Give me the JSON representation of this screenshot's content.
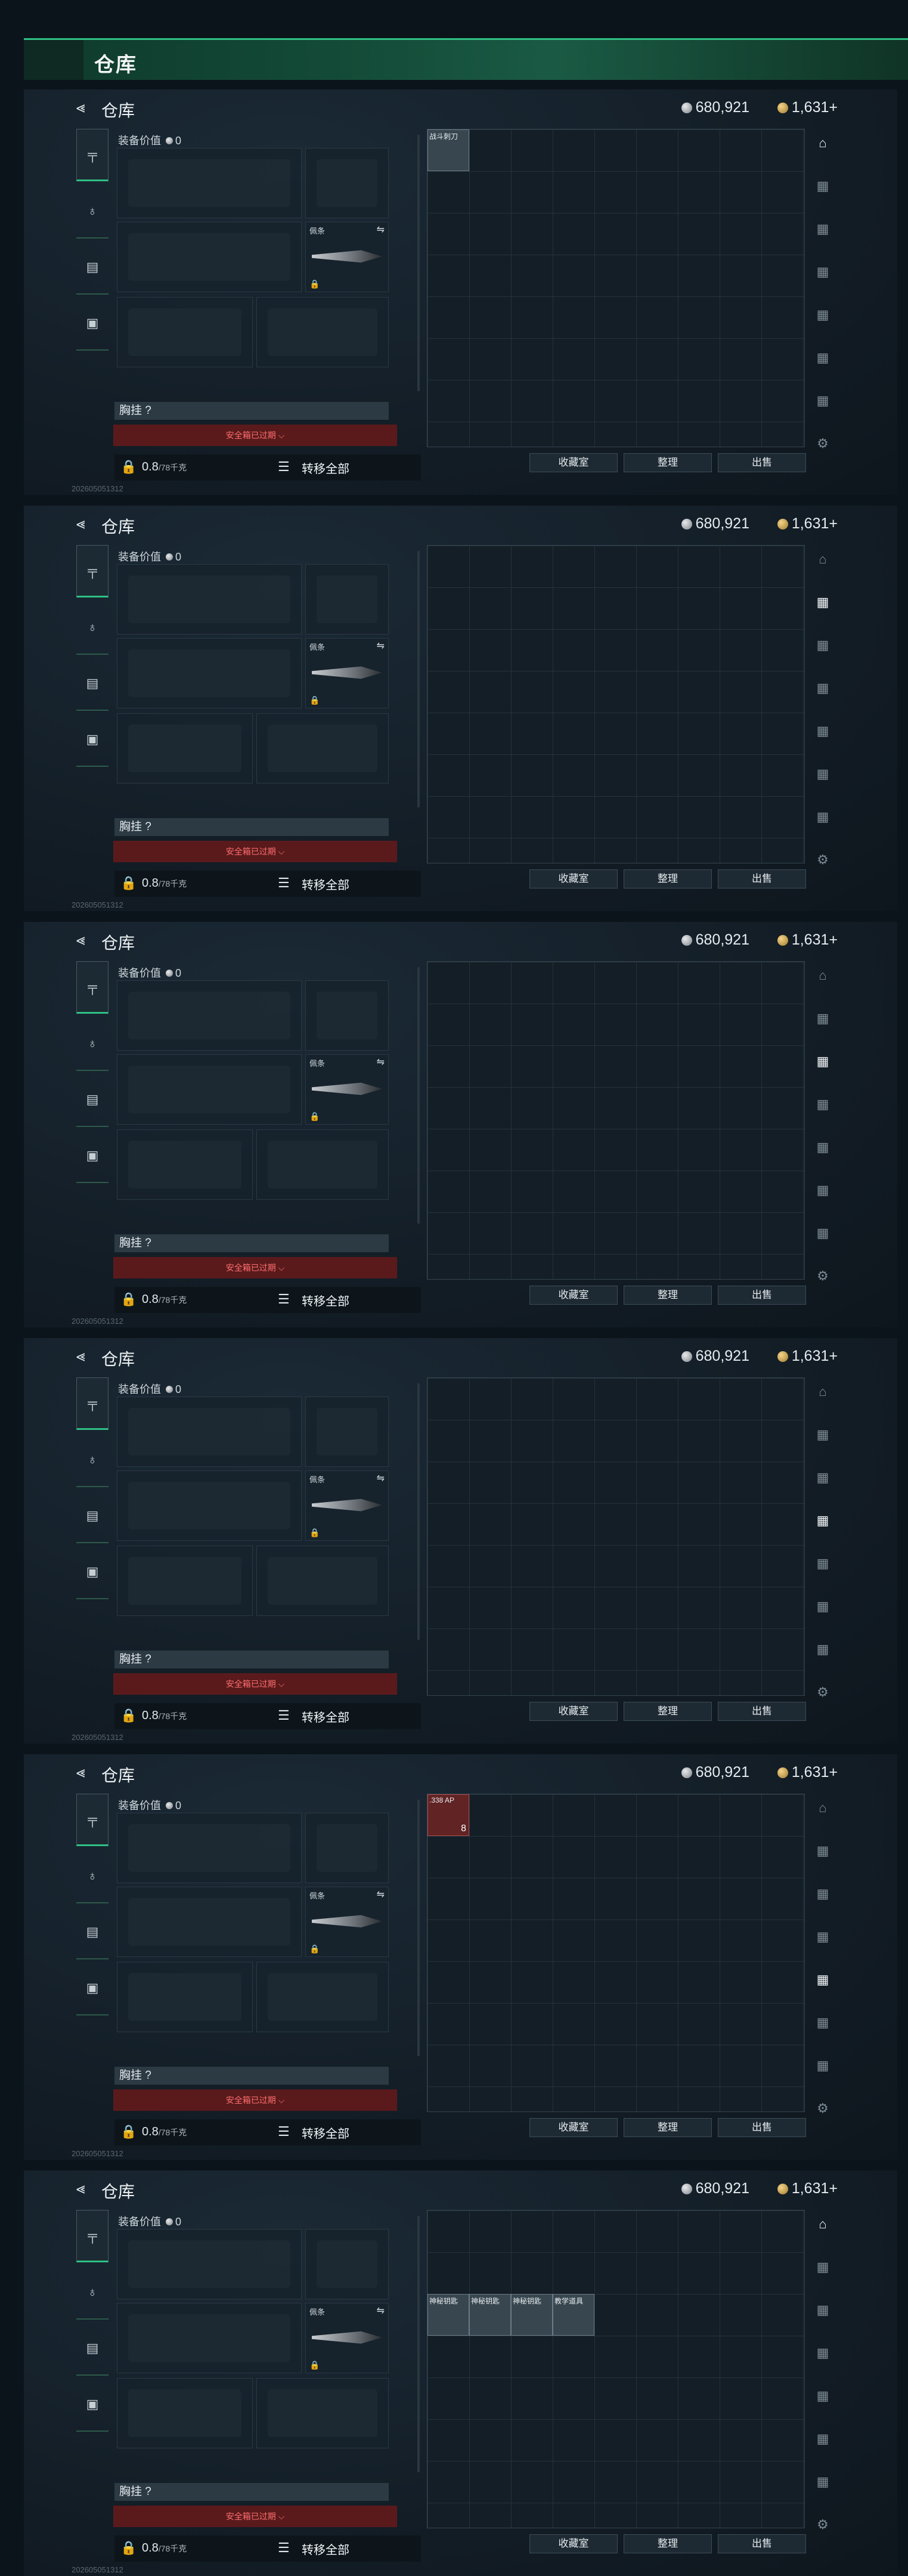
{
  "banner": {
    "title": "仓库"
  },
  "header": {
    "title": "仓库",
    "silver": "680,921",
    "gold": "1,631",
    "gold_plus": "+"
  },
  "equip": {
    "value_label": "装备价值",
    "value": "0",
    "knife_tag": "佩条",
    "chest_label": "胸挂 ?",
    "safe_label": "安全箱已过期 ⌵",
    "weight": "0.8",
    "weight_max": "/78千克",
    "transfer_all": "转移全部",
    "footer_code": "202605051312"
  },
  "grid_buttons": [
    "收藏室",
    "整理",
    "出售"
  ],
  "panels": [
    {
      "items": [
        {
          "label": "战斗刺刀",
          "style": "normal",
          "count": ""
        }
      ]
    },
    {
      "items": []
    },
    {
      "items": []
    },
    {
      "items": []
    },
    {
      "items": [
        {
          "label": ".338 AP",
          "style": "red",
          "count": "8"
        }
      ]
    },
    {
      "items": [
        {
          "label": "神秘钥匙",
          "style": "normal",
          "count": ""
        },
        {
          "label": "神秘钥匙",
          "style": "normal",
          "count": ""
        },
        {
          "label": "神秘钥匙",
          "style": "normal",
          "count": ""
        },
        {
          "label": "教学道具",
          "style": "normal",
          "count": ""
        }
      ]
    }
  ],
  "icons": {
    "back": "back-arrow-icon",
    "silver": "silver-coin-icon",
    "gold": "gold-coin-icon",
    "nav": [
      "pistol-icon",
      "helmet-icon",
      "vest-icon",
      "backpack-icon"
    ],
    "side": [
      "building-icon",
      "folder-icon",
      "folder-icon",
      "folder-icon",
      "folder-icon",
      "folder-icon",
      "folder-icon",
      "gear-icon"
    ]
  }
}
